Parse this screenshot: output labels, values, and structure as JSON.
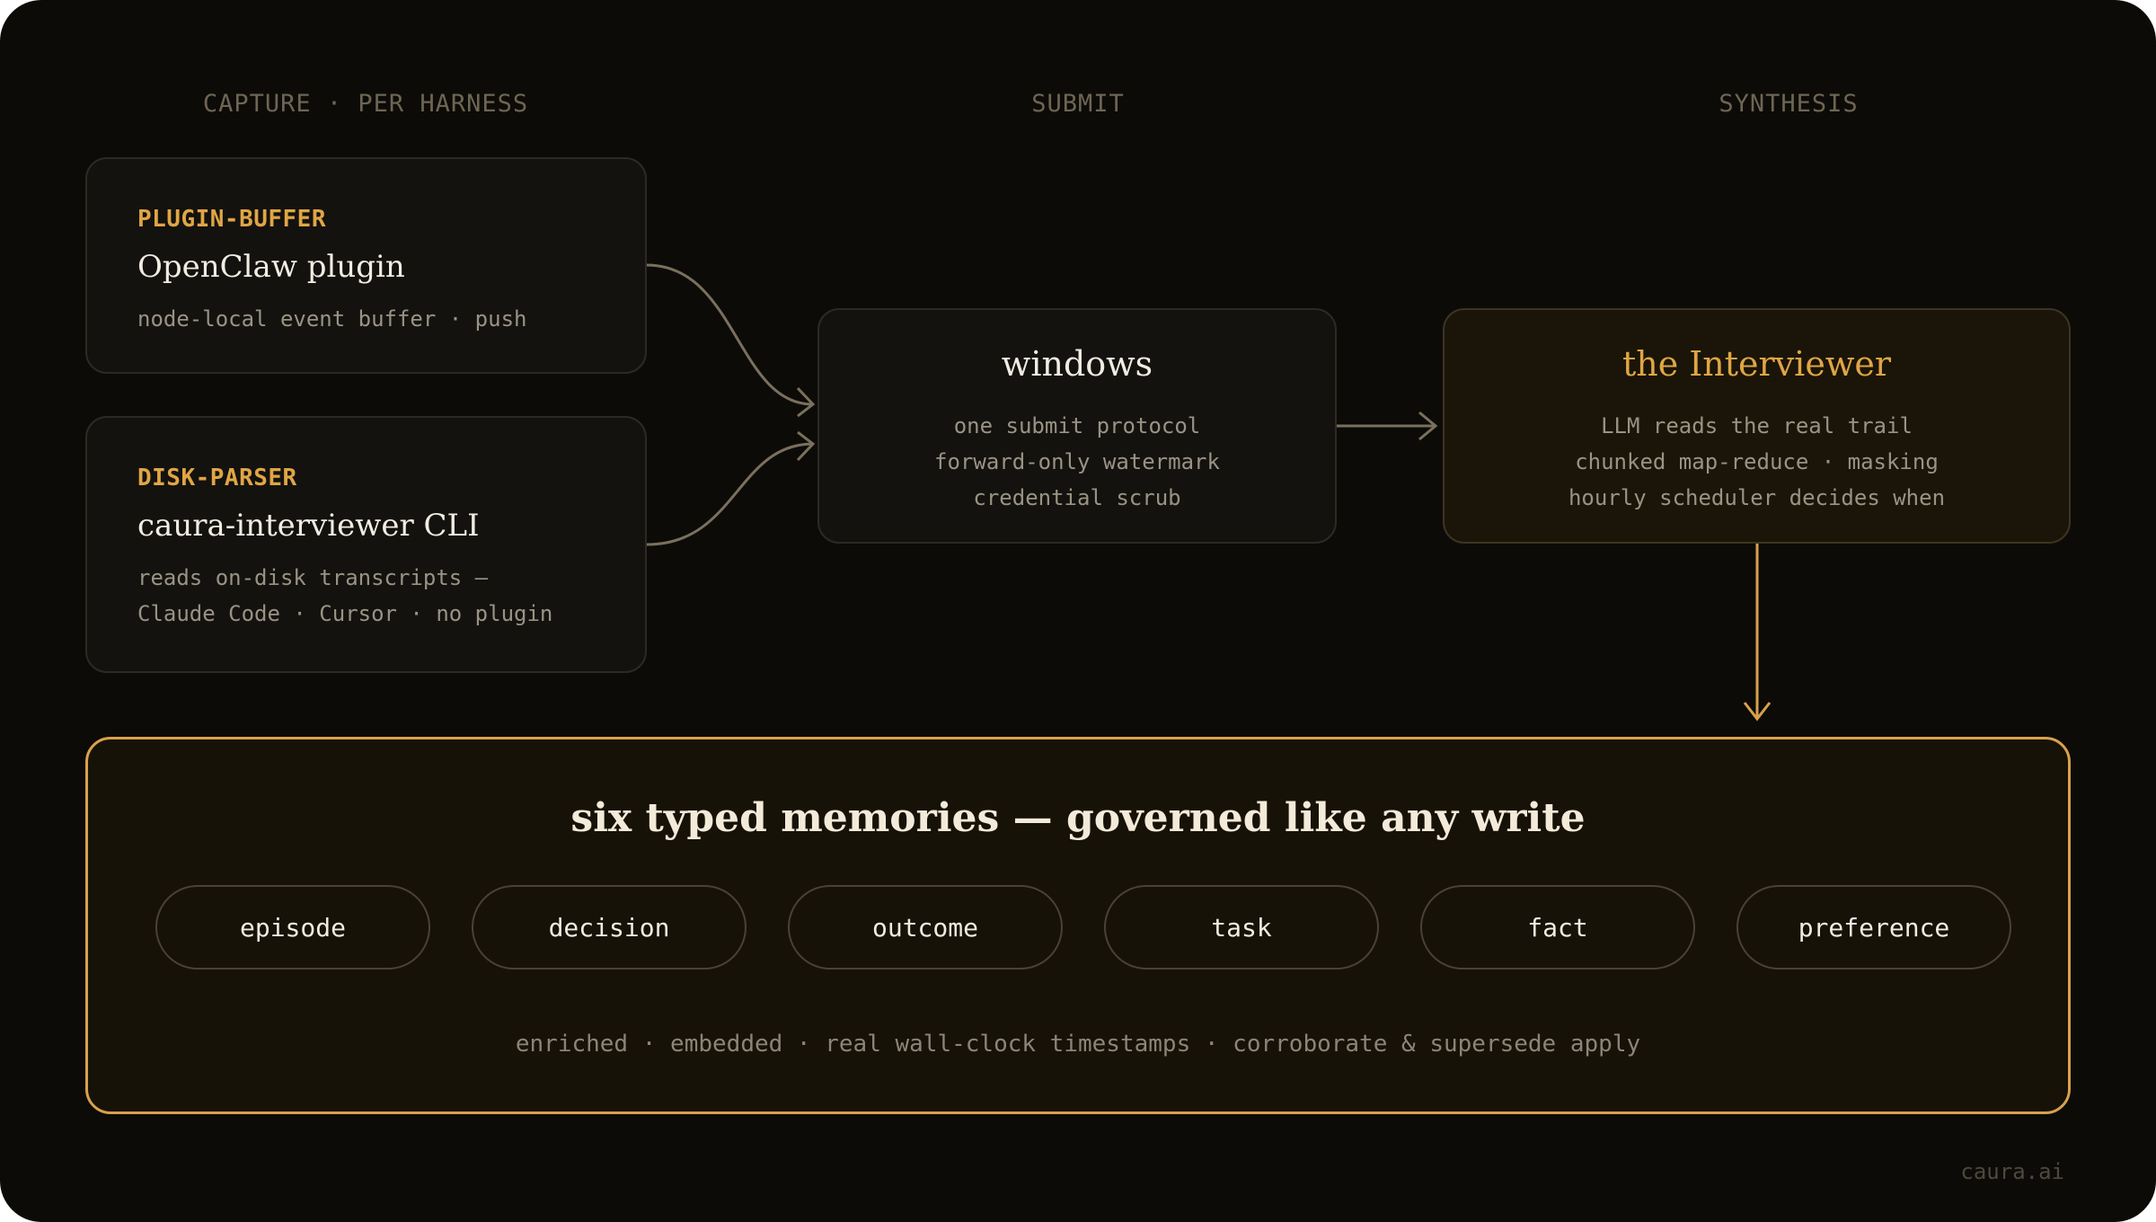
{
  "columns": {
    "capture": "CAPTURE · PER HARNESS",
    "submit": "SUBMIT",
    "synthesis": "SYNTHESIS"
  },
  "plugin_card": {
    "tag": "PLUGIN-BUFFER",
    "title": "OpenClaw plugin",
    "lines": [
      "node-local event buffer · push"
    ]
  },
  "disk_card": {
    "tag": "DISK-PARSER",
    "title": "caura-interviewer CLI",
    "lines": [
      "reads on-disk transcripts —",
      "Claude Code · Cursor · no plugin"
    ]
  },
  "windows_card": {
    "title": "windows",
    "lines": [
      "one submit protocol",
      "forward-only watermark",
      "credential scrub"
    ]
  },
  "interviewer_card": {
    "title": "the Interviewer",
    "lines": [
      "LLM reads the real trail",
      "chunked map-reduce · masking",
      "hourly scheduler decides when"
    ]
  },
  "memories": {
    "title": "six typed memories — governed like any write",
    "types": [
      "episode",
      "decision",
      "outcome",
      "task",
      "fact",
      "preference"
    ],
    "footer": "enriched · embedded · real wall-clock timestamps · corroborate & supersede apply"
  },
  "brand": "caura.ai",
  "colors": {
    "background": "#0c0b08",
    "accent": "#e0a545",
    "border": "#2c2a24",
    "connector": "#7a705d"
  }
}
